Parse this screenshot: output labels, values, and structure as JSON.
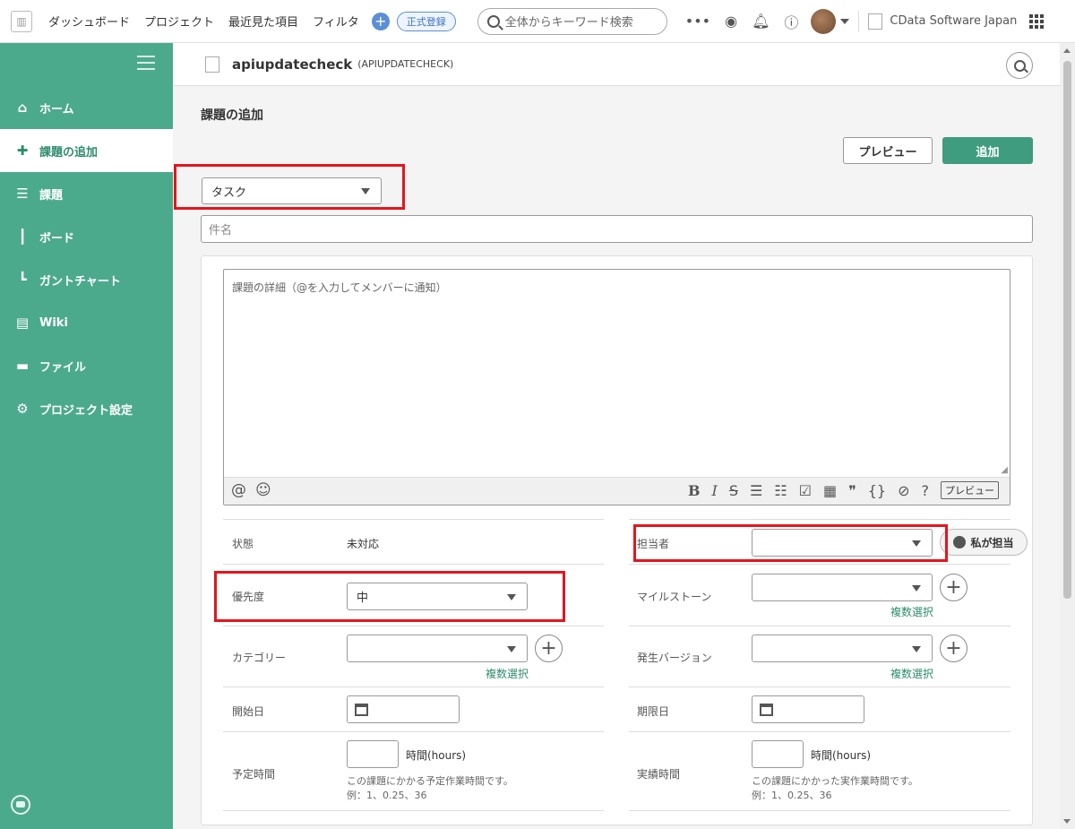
{
  "topbar": {
    "nav": [
      "ダッシュボード",
      "プロジェクト",
      "最近見た項目",
      "フィルタ"
    ],
    "register_label": "正式登録",
    "search_placeholder": "全体からキーワード検索",
    "more_label": "•••",
    "org_name": "CData Software Japan"
  },
  "sidebar": {
    "items": [
      {
        "label": "ホーム",
        "icon": "home-icon"
      },
      {
        "label": "課題の追加",
        "icon": "plus-icon"
      },
      {
        "label": "課題",
        "icon": "list-icon"
      },
      {
        "label": "ボード",
        "icon": "board-icon"
      },
      {
        "label": "ガントチャート",
        "icon": "gantt-icon"
      },
      {
        "label": "Wiki",
        "icon": "wiki-icon"
      },
      {
        "label": "ファイル",
        "icon": "folder-icon"
      },
      {
        "label": "プロジェクト設定",
        "icon": "gear-icon"
      }
    ],
    "active_index": 1
  },
  "project": {
    "name": "apiupdatecheck",
    "key": "(APIUPDATECHECK)"
  },
  "page": {
    "title": "課題の追加",
    "preview_label": "プレビュー",
    "add_label": "追加",
    "issue_type": "タスク",
    "subject_placeholder": "件名",
    "detail_placeholder": "課題の詳細（@を入力してメンバーに通知）",
    "editor_preview_label": "プレビュー"
  },
  "fields": {
    "status_label": "状態",
    "status_value": "未対応",
    "assignee_label": "担当者",
    "assignee_value": "",
    "assign_me_label": "私が担当",
    "priority_label": "優先度",
    "priority_value": "中",
    "milestone_label": "マイルストーン",
    "milestone_value": "",
    "category_label": "カテゴリー",
    "category_value": "",
    "version_label": "発生バージョン",
    "version_value": "",
    "multi_select_label": "複数選択",
    "start_date_label": "開始日",
    "due_date_label": "期限日",
    "estimated_label": "予定時間",
    "actual_label": "実績時間",
    "hours_unit": "時間(hours)",
    "estimated_help": "この課題にかかる予定作業時間です。",
    "actual_help": "この課題にかかった実作業時間です。",
    "example": "例：1、0.25、36"
  },
  "colors": {
    "accent": "#4caa8c",
    "add_button": "#3f9c7e",
    "highlight": "#e5151d"
  }
}
